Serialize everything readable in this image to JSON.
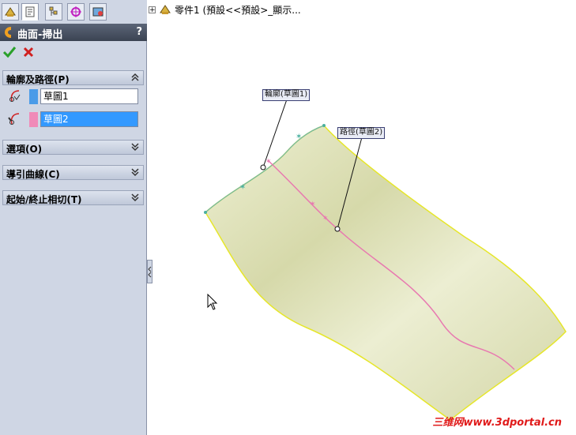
{
  "panel": {
    "title": "曲面-掃出",
    "help": "?",
    "tabs": [
      {
        "icon": "feature-manager-icon",
        "active": false
      },
      {
        "icon": "property-manager-icon",
        "active": true
      },
      {
        "icon": "configuration-manager-icon",
        "active": false
      },
      {
        "icon": "dimxpert-manager-icon",
        "active": false
      },
      {
        "icon": "display-manager-icon",
        "active": false
      }
    ],
    "ok_icon": "checkmark-icon",
    "cancel_icon": "x-icon",
    "sections": {
      "profile_path": {
        "title": "輪廓及路徑(P)",
        "expanded": true,
        "profile": {
          "value": "草圖1",
          "color": "#4a9be8",
          "icon": "profile-icon"
        },
        "path": {
          "value": "草圖2",
          "color": "#f08ab8",
          "icon": "path-icon",
          "selected": true
        }
      },
      "options": {
        "title": "選項(O)",
        "expanded": false
      },
      "guide_curves": {
        "title": "導引曲線(C)",
        "expanded": false
      },
      "tangency": {
        "title": "起始/終止相切(T)",
        "expanded": false
      }
    }
  },
  "tree": {
    "part_label": "零件1  (預設<<預設>_顯示..."
  },
  "viewport": {
    "callout_profile": "輪廓(草圖1)",
    "callout_path": "路徑(草圖2)",
    "surface_color": "#e4e6c4",
    "edge_color": "#e8e830",
    "path_color": "#e878b0"
  },
  "watermark": "三维网www.3dportal.cn"
}
